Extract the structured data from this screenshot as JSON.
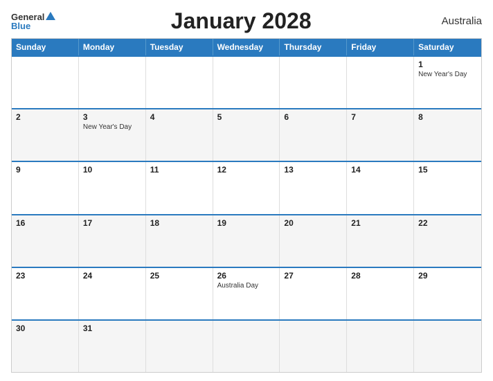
{
  "header": {
    "logo_general": "General",
    "logo_blue": "Blue",
    "title": "January 2028",
    "country": "Australia"
  },
  "calendar": {
    "days": [
      "Sunday",
      "Monday",
      "Tuesday",
      "Wednesday",
      "Thursday",
      "Friday",
      "Saturday"
    ],
    "rows": [
      [
        {
          "day": "",
          "event": ""
        },
        {
          "day": "",
          "event": ""
        },
        {
          "day": "",
          "event": ""
        },
        {
          "day": "",
          "event": ""
        },
        {
          "day": "",
          "event": ""
        },
        {
          "day": "",
          "event": ""
        },
        {
          "day": "1",
          "event": "New Year's Day"
        }
      ],
      [
        {
          "day": "2",
          "event": ""
        },
        {
          "day": "3",
          "event": "New Year's Day"
        },
        {
          "day": "4",
          "event": ""
        },
        {
          "day": "5",
          "event": ""
        },
        {
          "day": "6",
          "event": ""
        },
        {
          "day": "7",
          "event": ""
        },
        {
          "day": "8",
          "event": ""
        }
      ],
      [
        {
          "day": "9",
          "event": ""
        },
        {
          "day": "10",
          "event": ""
        },
        {
          "day": "11",
          "event": ""
        },
        {
          "day": "12",
          "event": ""
        },
        {
          "day": "13",
          "event": ""
        },
        {
          "day": "14",
          "event": ""
        },
        {
          "day": "15",
          "event": ""
        }
      ],
      [
        {
          "day": "16",
          "event": ""
        },
        {
          "day": "17",
          "event": ""
        },
        {
          "day": "18",
          "event": ""
        },
        {
          "day": "19",
          "event": ""
        },
        {
          "day": "20",
          "event": ""
        },
        {
          "day": "21",
          "event": ""
        },
        {
          "day": "22",
          "event": ""
        }
      ],
      [
        {
          "day": "23",
          "event": ""
        },
        {
          "day": "24",
          "event": ""
        },
        {
          "day": "25",
          "event": ""
        },
        {
          "day": "26",
          "event": "Australia Day"
        },
        {
          "day": "27",
          "event": ""
        },
        {
          "day": "28",
          "event": ""
        },
        {
          "day": "29",
          "event": ""
        }
      ],
      [
        {
          "day": "30",
          "event": ""
        },
        {
          "day": "31",
          "event": ""
        },
        {
          "day": "",
          "event": ""
        },
        {
          "day": "",
          "event": ""
        },
        {
          "day": "",
          "event": ""
        },
        {
          "day": "",
          "event": ""
        },
        {
          "day": "",
          "event": ""
        }
      ]
    ]
  }
}
